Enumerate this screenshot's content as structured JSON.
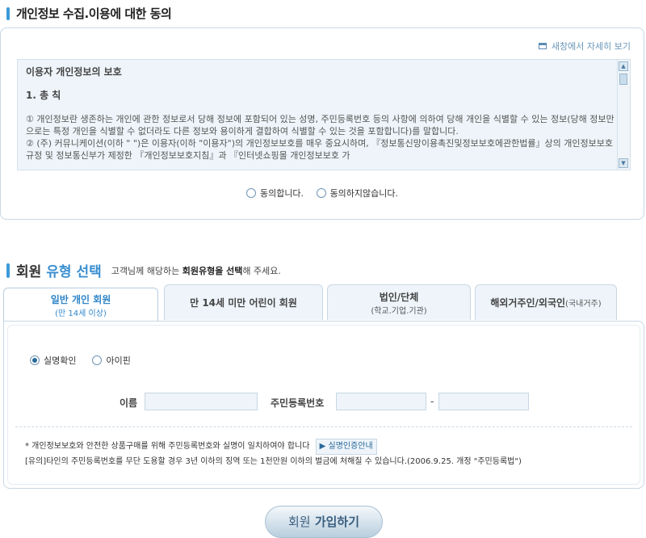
{
  "privacy": {
    "title": "개인정보 수집.이용에 대한 동의",
    "popup_link": "새창에서 자세히 보기",
    "terms_heading": "이용자 개인정보의 보호",
    "terms_section": "1. 총 칙",
    "terms_p1": "① 개인정보란 생존하는 개인에 관한 정보로서 당해 정보에 포함되어 있는 성명, 주민등록번호 등의 사항에 의하여 당해 개인을 식별할 수 있는 정보(당해 정보만으로는 특정 개인을 식별할 수 없더라도 다른 정보와 용이하게 결합하여 식별할 수 있는 것을 포함합니다)를 말합니다.",
    "terms_p2": "② (주)      커뮤니케이션(이하 \"      \")은       이용자(이하 \"이용자\")의 개인정보보호를 매우 중요시하며, 『정보통신망이용촉진및정보보호에관한법률』상의 개인정보보호규정 및 정보통신부가 제정한 『개인정보보호지침』과 『인터넷쇼핑몰 개인정보보호 가",
    "agree_label": "동의합니다.",
    "disagree_label": "동의하지않습니다."
  },
  "member": {
    "title_a": "회원",
    "title_b": "유형 선택",
    "subtitle_pre": "고객님께 해당하는",
    "subtitle_bold": "회원유형을 선택",
    "subtitle_post": "해 주세요.",
    "tabs": [
      {
        "label": "일반 개인 회원",
        "sub": "(만 14세 이상)"
      },
      {
        "label": "만 14세 미만 어린이 회원",
        "sub": ""
      },
      {
        "label": "법인/단체",
        "sub": "(학교.기업.기관)"
      },
      {
        "label": "해외거주인/외국인",
        "sub": "(국내거주)"
      }
    ],
    "auth_options": [
      "실명확인",
      "아이핀"
    ],
    "name_label": "이름",
    "rrn_label": "주민등록번호",
    "dash": "-",
    "note1": "* 개인정보보호와 안전한 상품구매를 위해 주민등록번호와 실명이 일치하여야 합니다",
    "guide_button": "▶ 실명인증안내",
    "note2": "[유의]타인의 주민등록번호를 무단 도용할 경우 3년 이하의 징역 또는 1천만원 이하의 벌금에 처해질 수 있습니다.(2006.9.25. 개정 \"주민등록법\")",
    "join_button_a": "회원",
    "join_button_b": "가입하기"
  },
  "colors": {
    "accent": "#3a9ad9",
    "border": "#c9d8e4",
    "input_bg": "#eef4f9"
  }
}
